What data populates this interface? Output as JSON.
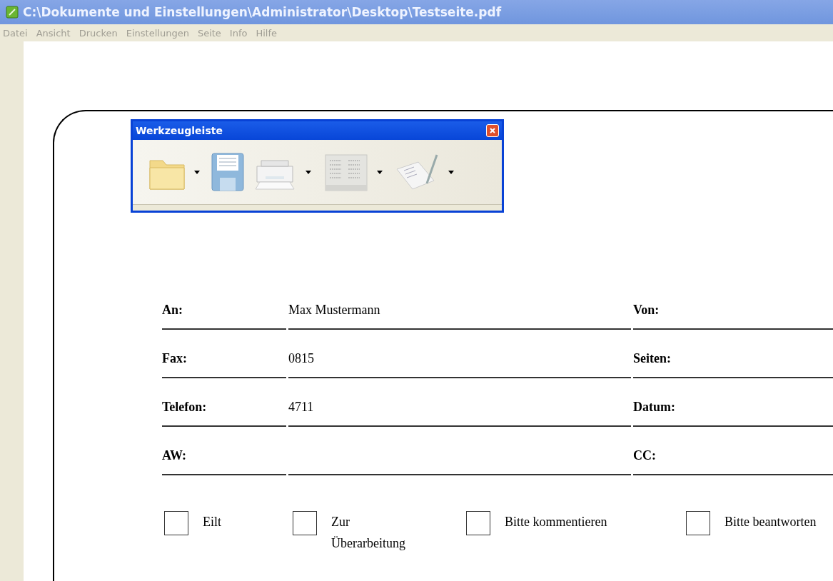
{
  "window": {
    "title": "C:\\Dokumente und Einstellungen\\Administrator\\Desktop\\Testseite.pdf"
  },
  "menu": [
    "Datei",
    "Ansicht",
    "Drucken",
    "Einstellungen",
    "Seite",
    "Info",
    "Hilfe"
  ],
  "toolbar": {
    "title": "Werkzeugleiste",
    "tools": [
      {
        "kind": "folder",
        "dropdown": true
      },
      {
        "kind": "disk",
        "dropdown": false
      },
      {
        "kind": "printer",
        "dropdown": true
      },
      {
        "kind": "form",
        "dropdown": true
      },
      {
        "kind": "sign",
        "dropdown": true
      }
    ]
  },
  "form": {
    "rows": [
      {
        "label": "An:",
        "value": "Max Mustermann",
        "right_label": "Von:"
      },
      {
        "label": "Fax:",
        "value": "0815",
        "right_label": "Seiten:"
      },
      {
        "label": "Telefon:",
        "value": "4711",
        "right_label": "Datum:"
      },
      {
        "label": "AW:",
        "value": "",
        "right_label": "CC:"
      }
    ],
    "checkboxes": [
      {
        "label": "Eilt",
        "checked": false
      },
      {
        "label": "Zur Überarbeitung",
        "checked": false
      },
      {
        "label": "Bitte kommentieren",
        "checked": false
      },
      {
        "label": "Bitte beantworten",
        "checked": false
      }
    ]
  }
}
